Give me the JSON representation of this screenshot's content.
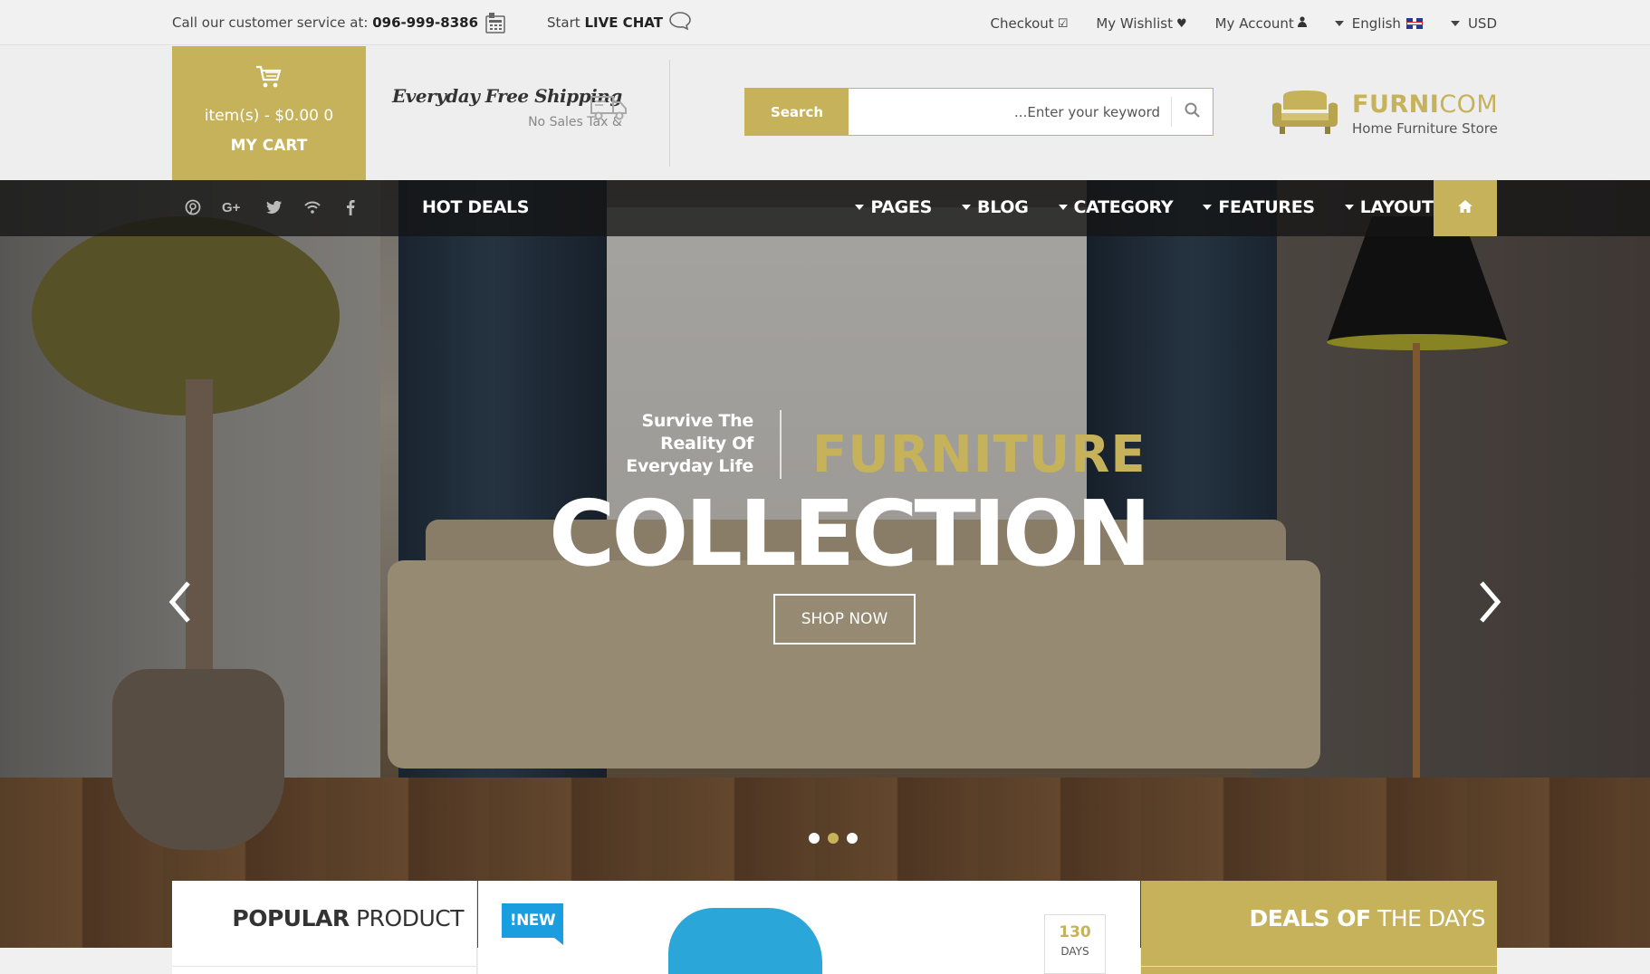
{
  "topbar": {
    "service_prefix": "Call our customer service at:",
    "service_phone": "096-999-8386",
    "chat_prefix": "Start",
    "chat_label": "LIVE CHAT",
    "checkout": "Checkout",
    "wishlist": "My Wishlist",
    "account": "My Account",
    "language": "English",
    "currency": "USD"
  },
  "header": {
    "cart_items": "item(s) - $0.00 0",
    "cart_label": "MY CART",
    "shipping_title": "Everyday Free Shipping",
    "shipping_sub": "No Sales Tax &",
    "search_button": "Search",
    "search_placeholder": "...Enter your keyword",
    "logo_bold": "FURNI",
    "logo_light": "COM",
    "logo_tagline": "Home Furniture Store"
  },
  "nav": {
    "hot_deals": "HOT DEALS",
    "items": [
      "PAGES",
      "BLOG",
      "CATEGORY",
      "FEATURES",
      "LAYOUTS"
    ],
    "social_icons": [
      "pinterest-icon",
      "google-plus-icon",
      "twitter-icon",
      "rss-icon",
      "facebook-icon"
    ]
  },
  "hero": {
    "slogan_line1": "Survive The",
    "slogan_line2": "Reality Of",
    "slogan_line3": "Everyday Life",
    "headline_accent": "FURNITURE",
    "headline_main": "COLLECTION",
    "cta": "SHOP NOW",
    "slides": 3,
    "active_slide": 2
  },
  "bottom": {
    "popular_bold": "POPULAR",
    "popular_light": "PRODUCT",
    "new_badge": "!NEW",
    "days_value": "130",
    "days_label": "DAYS",
    "deals_bold": "DEALS OF",
    "deals_light": "THE DAYS"
  },
  "colors": {
    "accent": "#c5b25a",
    "nav_bg": "#141414",
    "new_badge": "#1a9ee0"
  }
}
